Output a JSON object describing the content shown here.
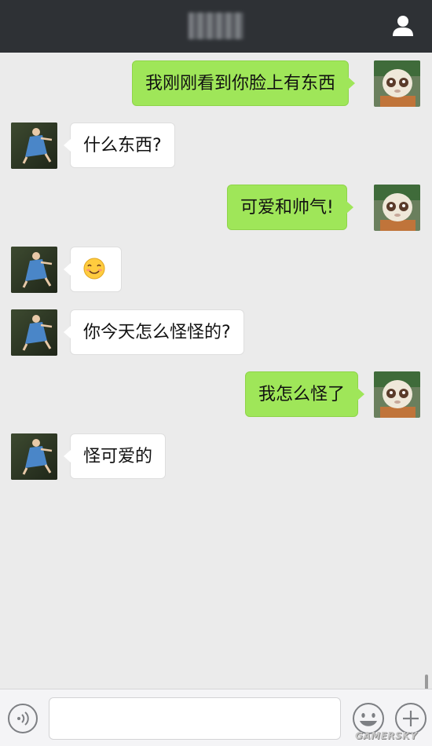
{
  "header": {
    "title": "",
    "profile_icon": "person-icon"
  },
  "messages": [
    {
      "side": "out",
      "text": "我刚刚看到你脸上有东西",
      "avatar": "plush-doll-avatar"
    },
    {
      "side": "in",
      "text": "什么东西?",
      "avatar": "girl-photo-avatar"
    },
    {
      "side": "out",
      "text": "可爱和帅气!",
      "avatar": "plush-doll-avatar"
    },
    {
      "side": "in",
      "text": "",
      "emoji": "smiling-face-with-heart-eyes",
      "avatar": "girl-photo-avatar"
    },
    {
      "side": "in",
      "text": "你今天怎么怪怪的?",
      "avatar": "girl-photo-avatar"
    },
    {
      "side": "out",
      "text": "我怎么怪了",
      "avatar": "plush-doll-avatar"
    },
    {
      "side": "in",
      "text": "怪可爱的",
      "avatar": "girl-photo-avatar"
    }
  ],
  "input_bar": {
    "voice_icon": "voice-icon",
    "input_value": "",
    "input_placeholder": "",
    "emoji_icon": "emoji-icon",
    "plus_icon": "plus-icon"
  },
  "watermark": "GAMERSKY",
  "colors": {
    "header_bg": "#2e3135",
    "chat_bg": "#ebebeb",
    "outgoing_bubble": "#9fe659",
    "incoming_bubble": "#ffffff"
  }
}
